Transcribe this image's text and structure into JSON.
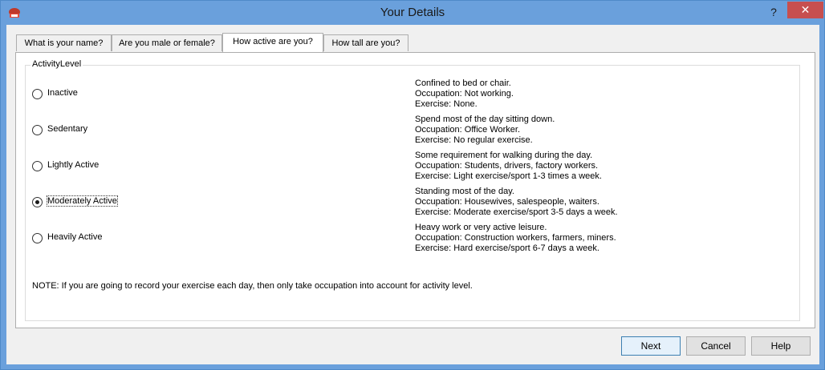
{
  "window": {
    "title": "Your Details",
    "help_glyph": "?",
    "close_glyph": "✕"
  },
  "tabs": [
    {
      "label": "What is your name?"
    },
    {
      "label": "Are you male or female?"
    },
    {
      "label": "How active are you?"
    },
    {
      "label": "How tall are you?"
    }
  ],
  "group": {
    "label": "ActivityLevel"
  },
  "options": [
    {
      "label": "Inactive",
      "selected": false,
      "desc": [
        "Confined to bed or chair.",
        "Occupation: Not working.",
        "Exercise: None."
      ]
    },
    {
      "label": "Sedentary",
      "selected": false,
      "desc": [
        "Spend most of the day sitting down.",
        "Occupation: Office Worker.",
        "Exercise: No regular exercise."
      ]
    },
    {
      "label": "Lightly Active",
      "selected": false,
      "desc": [
        "Some requirement for walking during the day.",
        "Occupation: Students, drivers, factory workers.",
        "Exercise: Light exercise/sport 1-3 times a week."
      ]
    },
    {
      "label": "Moderately Active",
      "selected": true,
      "desc": [
        "Standing most of the day.",
        "Occupation: Housewives, salespeople, waiters.",
        "Exercise: Moderate exercise/sport 3-5 days a week."
      ]
    },
    {
      "label": "Heavily Active",
      "selected": false,
      "desc": [
        "Heavy work or very active leisure.",
        "Occupation: Construction workers, farmers, miners.",
        "Exercise: Hard exercise/sport 6-7 days a week."
      ]
    }
  ],
  "note": "NOTE: If you are going to record your exercise each day, then only take occupation into account for activity level.",
  "buttons": {
    "next": "Next",
    "cancel": "Cancel",
    "help": "Help"
  }
}
